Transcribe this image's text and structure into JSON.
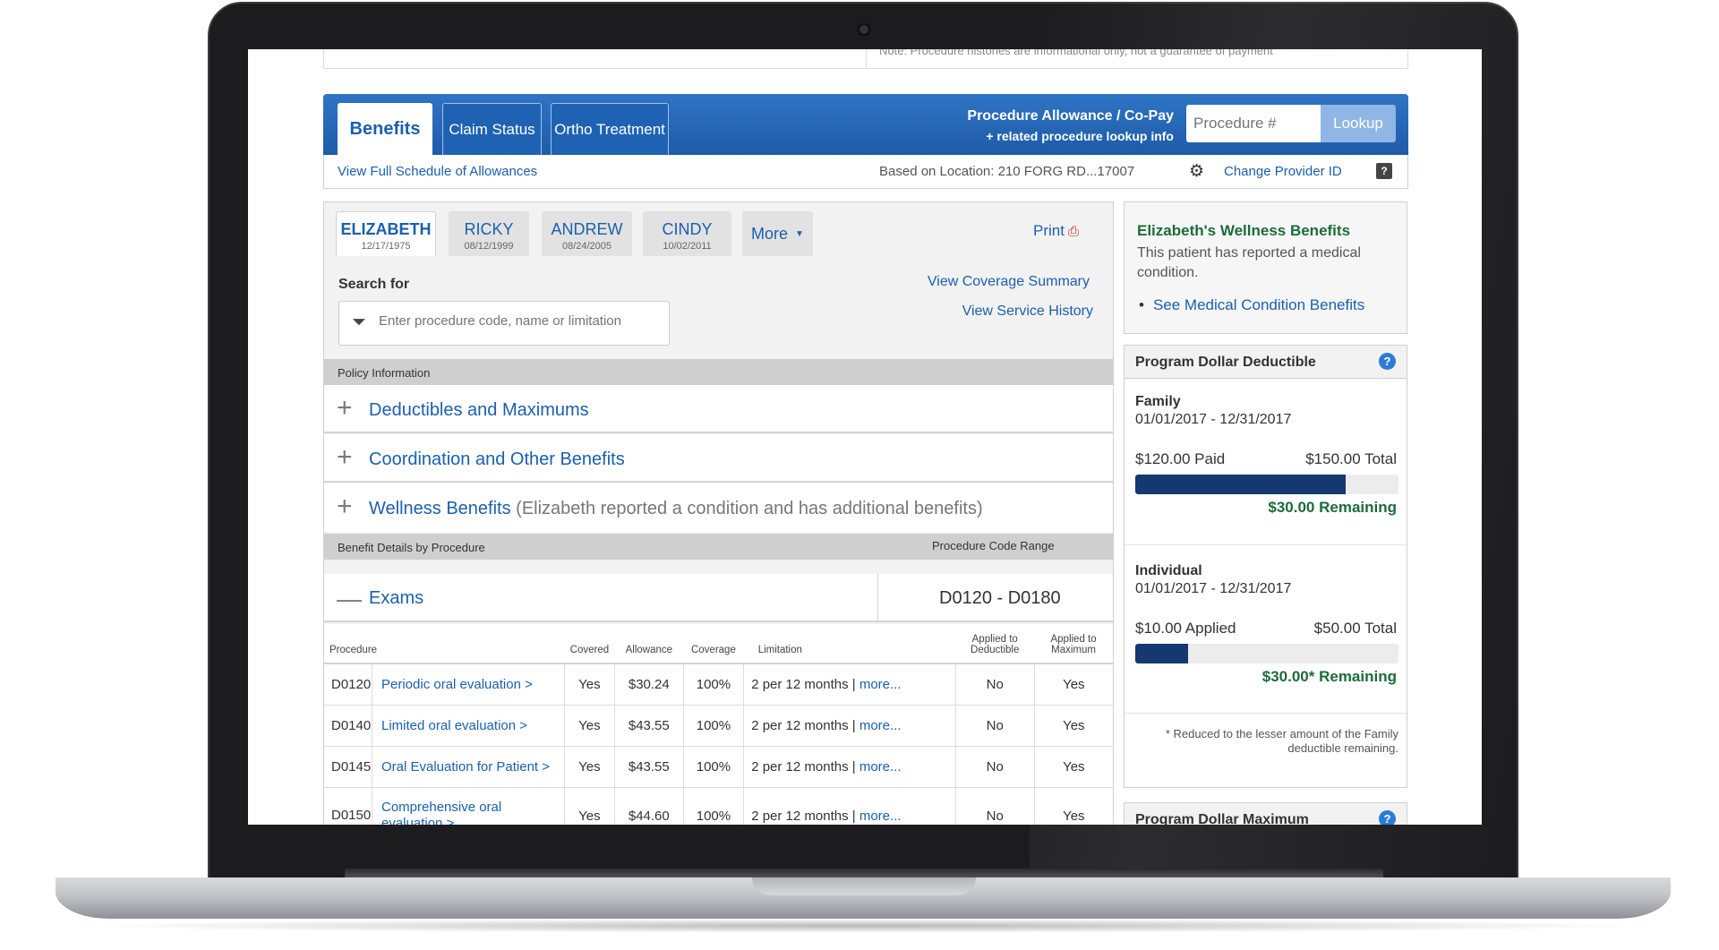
{
  "top_note": "Note: Procedure histories are informational only, not a guarantee of payment",
  "tabs": [
    {
      "label": "Benefits"
    },
    {
      "label": "Claim Status"
    },
    {
      "label": "Ortho Treatment"
    }
  ],
  "procedure_lookup": {
    "title_line1": "Procedure Allowance / Co-Pay",
    "title_line2": "+ related procedure lookup info",
    "placeholder": "Procedure #",
    "button": "Lookup"
  },
  "subbar": {
    "schedule_link": "View Full Schedule of Allowances",
    "location": "Based on Location: 210 FORG RD...17007",
    "change_provider": "Change Provider ID",
    "help": "?"
  },
  "patients": [
    {
      "name": "ELIZABETH",
      "dob": "12/17/1975"
    },
    {
      "name": "RICKY",
      "dob": "08/12/1999"
    },
    {
      "name": "ANDREW",
      "dob": "08/24/2005"
    },
    {
      "name": "CINDY",
      "dob": "10/02/2011"
    }
  ],
  "more_label": "More",
  "print_label": "Print",
  "search": {
    "label": "Search for",
    "placeholder": "Enter procedure code, name or limitation",
    "coverage_summary": "View Coverage Summary",
    "service_history": "View Service History"
  },
  "policy_header": "Policy Information",
  "accordion": [
    {
      "label": "Deductibles and Maximums"
    },
    {
      "label": "Coordination and Other Benefits"
    },
    {
      "label": "Wellness Benefits",
      "sub": "(Elizabeth reported a condition and has additional benefits)"
    }
  ],
  "benefit_header": {
    "left": "Benefit Details by Procedure",
    "right": "Procedure Code Range"
  },
  "exams": {
    "label": "Exams",
    "range": "D0120 - D0180"
  },
  "table": {
    "headers": {
      "procedure": "Procedure",
      "covered": "Covered",
      "allowance": "Allowance",
      "coverage": "Coverage",
      "limitation": "Limitation",
      "deductible": "Applied to Deductible",
      "maximum": "Applied to Maximum"
    },
    "rows": [
      {
        "code": "D0120",
        "name": "Periodic oral evaluation >",
        "covered": "Yes",
        "allowance": "$30.24",
        "coverage": "100%",
        "limitation": "2 per 12 months |",
        "more": "more...",
        "deductible": "No",
        "maximum": "Yes"
      },
      {
        "code": "D0140",
        "name": "Limited oral evaluation >",
        "covered": "Yes",
        "allowance": "$43.55",
        "coverage": "100%",
        "limitation": "2 per 12 months |",
        "more": "more...",
        "deductible": "No",
        "maximum": "Yes"
      },
      {
        "code": "D0145",
        "name": "Oral Evaluation for Patient >",
        "covered": "Yes",
        "allowance": "$43.55",
        "coverage": "100%",
        "limitation": "2 per 12 months |",
        "more": "more...",
        "deductible": "No",
        "maximum": "Yes"
      },
      {
        "code": "D0150",
        "name": "Comprehensive oral evaluation >",
        "covered": "Yes",
        "allowance": "$44.60",
        "coverage": "100%",
        "limitation": "2 per 12 months |",
        "more": "more...",
        "deductible": "No",
        "maximum": "Yes"
      }
    ]
  },
  "wellness": {
    "title": "Elizabeth's Wellness Benefits",
    "text": "This patient has reported a medical condition.",
    "link": "See Medical Condition Benefits"
  },
  "deductible": {
    "title": "Program Dollar Deductible",
    "family": {
      "label": "Family",
      "dates": "01/01/2017 - 12/31/2017",
      "paid": "$120.00 Paid",
      "total": "$150.00 Total",
      "remaining": "$30.00 Remaining",
      "fraction": 0.8
    },
    "individual": {
      "label": "Individual",
      "dates": "01/01/2017 - 12/31/2017",
      "paid": "$10.00 Applied",
      "total": "$50.00 Total",
      "remaining": "$30.00* Remaining",
      "fraction": 0.2
    },
    "footnote": "* Reduced to the lesser amount of the Family deductible remaining."
  },
  "maximum": {
    "title": "Program Dollar Maximum"
  },
  "colors": {
    "brand_blue": "#1e5ba8",
    "link_blue": "#1b5fae",
    "remaining_green": "#1d6b3a",
    "bar_fill": "#14386f"
  }
}
